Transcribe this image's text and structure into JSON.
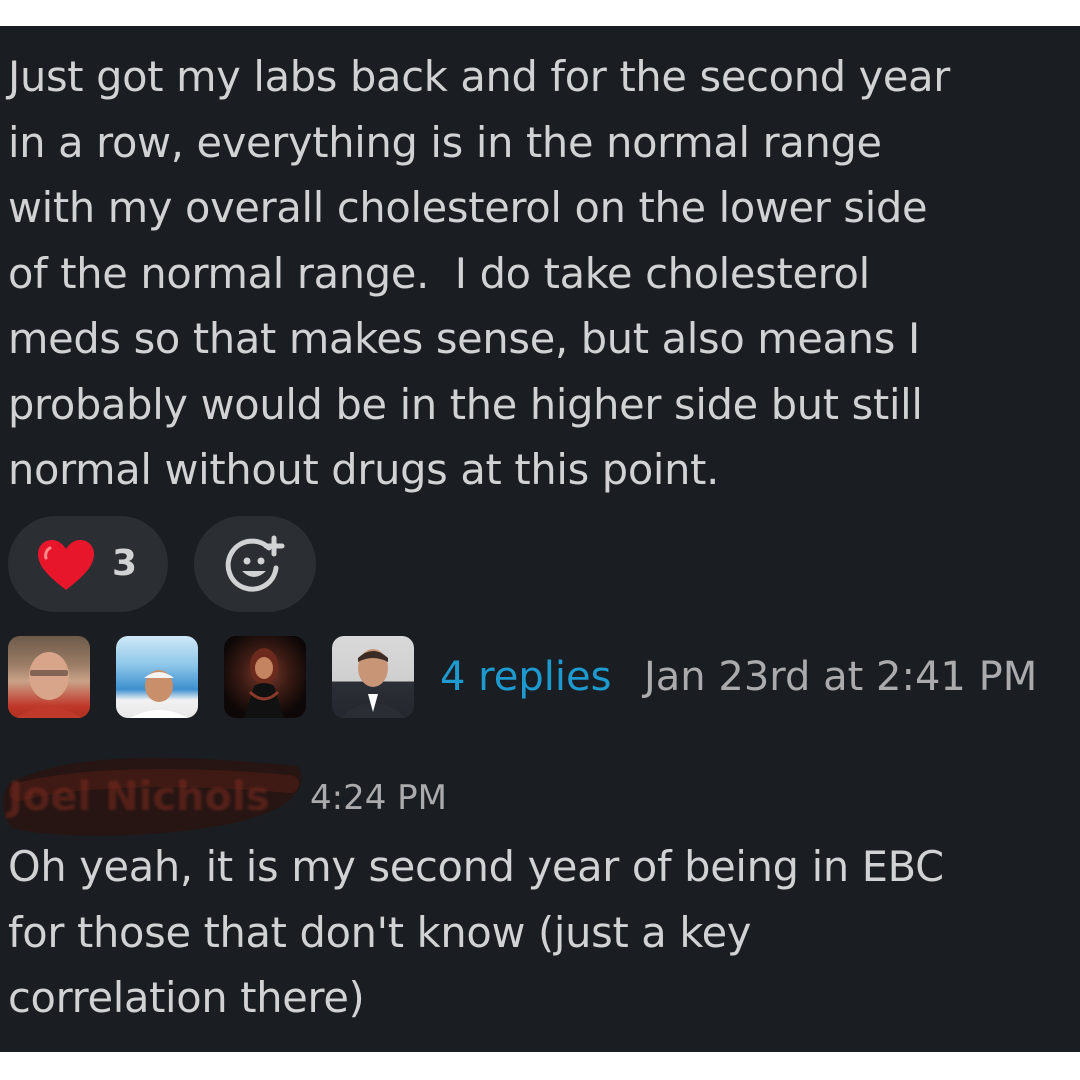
{
  "message": {
    "text_lines": [
      "Just got my labs back and for the second year",
      "in a row, everything is in the normal range",
      "with my overall cholesterol on the lower side",
      "of the normal range.  I do take cholesterol",
      "meds so that makes sense, but also means I",
      "probably would be in the higher side but still",
      "normal without drugs at this point."
    ]
  },
  "reactions": {
    "heart": {
      "icon": "heart-icon",
      "count": "3"
    },
    "add_icon": "add-reaction-icon"
  },
  "thread": {
    "replies_label": "4 replies",
    "timestamp": "Jan 23rd at 2:41 PM",
    "link_color": "#1d9bd1"
  },
  "reply": {
    "author": "Joel Nichols",
    "time": "4:24 PM",
    "text_lines": [
      "Oh yeah, it is my second year of being in EBC",
      "for those that don't know (just a key",
      "correlation there)"
    ]
  },
  "colors": {
    "background": "#1a1d21",
    "text": "#d1d2d3",
    "muted": "#ababad",
    "pill": "#2b2e33",
    "heart": "#e8162a"
  }
}
